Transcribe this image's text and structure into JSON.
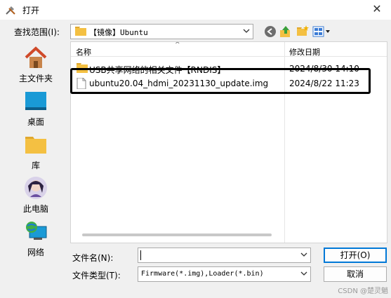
{
  "window": {
    "title": "打开",
    "close_label": "✕"
  },
  "look_in": {
    "label": "查找范围(I):",
    "path": "【镜像】Ubuntu"
  },
  "places": [
    {
      "label": "主文件夹"
    },
    {
      "label": "桌面"
    },
    {
      "label": "库"
    },
    {
      "label": "此电脑"
    },
    {
      "label": "网络"
    }
  ],
  "file_list": {
    "columns": {
      "name": "名称",
      "modified": "修改日期"
    },
    "rows": [
      {
        "name": "USB共享网络的相关文件【RNDIS】",
        "modified": "2024/8/30 14:10",
        "type": "folder"
      },
      {
        "name": "ubuntu20.04_hdmi_20231130_update.img",
        "modified": "2024/8/22 11:23",
        "type": "file"
      }
    ]
  },
  "file_name": {
    "label": "文件名(N):",
    "value": ""
  },
  "file_type": {
    "label": "文件类型(T):",
    "value": "Firmware(*.img),Loader(*.bin)"
  },
  "buttons": {
    "open": "打开(O)",
    "cancel": "取消"
  },
  "watermark": "CSDN @楚灵魈",
  "colors": {
    "accent": "#0078d7",
    "folder": "#f4c042"
  }
}
